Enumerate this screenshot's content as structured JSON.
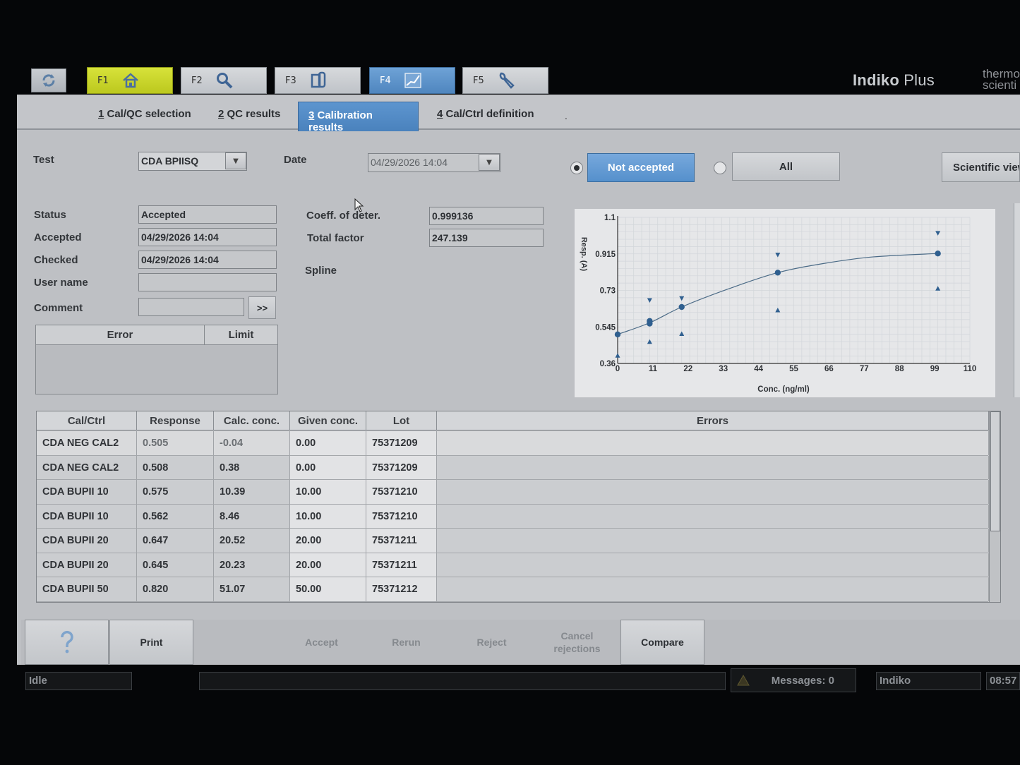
{
  "app": {
    "brand_main": "Indiko",
    "brand_plus": " Plus",
    "vendor_line1": "thermo",
    "vendor_line2": "scienti"
  },
  "fkeys": [
    {
      "label": "F1",
      "icon": "home-icon"
    },
    {
      "label": "F2",
      "icon": "search-icon"
    },
    {
      "label": "F3",
      "icon": "sample-icon"
    },
    {
      "label": "F4",
      "icon": "chart-icon"
    },
    {
      "label": "F5",
      "icon": "wrench-icon"
    }
  ],
  "tabs": [
    {
      "num": "1",
      "text": " Cal/QC selection"
    },
    {
      "num": "2",
      "text": " QC results"
    },
    {
      "num": "3",
      "text": " Calibration results"
    },
    {
      "num": "4",
      "text": " Cal/Ctrl definition"
    }
  ],
  "form": {
    "test_label": "Test",
    "test_value": "CDA BPIISQ",
    "date_label": "Date",
    "date_value": "04/29/2026 14:04",
    "status_label": "Status",
    "status_value": "Accepted",
    "accepted_label": "Accepted",
    "accepted_value": "04/29/2026 14:04",
    "checked_label": "Checked",
    "checked_value": "04/29/2026 14:04",
    "username_label": "User name",
    "username_value": "",
    "comment_label": "Comment",
    "comment_value": "",
    "more_button": ">>",
    "coeff_label": "Coeff. of deter.",
    "coeff_value": "0.999136",
    "total_factor_label": "Total factor",
    "total_factor_value": "247.139",
    "method": "Spline"
  },
  "filter": {
    "not_accepted": "Not accepted",
    "all": "All",
    "selected": "not_accepted",
    "scientific_view": "Scientific view"
  },
  "error_table": {
    "col_error": "Error",
    "col_limit": "Limit"
  },
  "chart_data": {
    "type": "scatter",
    "xlabel": "Conc. (ng/ml)",
    "ylabel": "Resp. (A)",
    "xlim": [
      0,
      110
    ],
    "ylim": [
      0.36,
      1.1
    ],
    "x_ticks": [
      "0",
      "11",
      "22",
      "33",
      "44",
      "55",
      "66",
      "77",
      "88",
      "99",
      "110"
    ],
    "y_ticks": [
      "1.1",
      "0.915",
      "0.73",
      "0.545",
      "0.36"
    ],
    "grid": true,
    "series": [
      {
        "name": "",
        "marker": "circle",
        "x": [
          0,
          10,
          10,
          20,
          50,
          100
        ],
        "y": [
          0.507,
          0.575,
          0.562,
          0.646,
          0.82,
          0.917
        ]
      },
      {
        "name": "",
        "marker": "triangle-down",
        "x": [
          10,
          20,
          50,
          100
        ],
        "y": [
          0.68,
          0.69,
          0.91,
          1.02
        ]
      },
      {
        "name": "",
        "marker": "triangle-up",
        "x": [
          0,
          10,
          20,
          50,
          100
        ],
        "y": [
          0.4,
          0.47,
          0.51,
          0.63,
          0.74
        ]
      }
    ],
    "curve": {
      "x": [
        0,
        10,
        20,
        35,
        50,
        65,
        80,
        100
      ],
      "y": [
        0.507,
        0.566,
        0.646,
        0.74,
        0.82,
        0.868,
        0.9,
        0.917
      ]
    }
  },
  "data_table": {
    "headers": [
      "Cal/Ctrl",
      "Response",
      "Calc. conc.",
      "Given conc.",
      "Lot",
      "Errors"
    ],
    "rows": [
      [
        "CDA NEG CAL2",
        "0.505",
        "-0.04",
        "0.00",
        "75371209",
        ""
      ],
      [
        "CDA NEG CAL2",
        "0.508",
        "0.38",
        "0.00",
        "75371209",
        ""
      ],
      [
        "CDA BUPII 10",
        "0.575",
        "10.39",
        "10.00",
        "75371210",
        ""
      ],
      [
        "CDA BUPII 10",
        "0.562",
        "8.46",
        "10.00",
        "75371210",
        ""
      ],
      [
        "CDA BUPII 20",
        "0.647",
        "20.52",
        "20.00",
        "75371211",
        ""
      ],
      [
        "CDA BUPII 20",
        "0.645",
        "20.23",
        "20.00",
        "75371211",
        ""
      ],
      [
        "CDA BUPII 50",
        "0.820",
        "51.07",
        "50.00",
        "75371212",
        ""
      ]
    ]
  },
  "toolbar": {
    "help_icon": "question-mark-icon",
    "print": "Print",
    "accept": "Accept",
    "rerun": "Rerun",
    "reject": "Reject",
    "cancel_rejections_1": "Cancel",
    "cancel_rejections_2": "rejections",
    "compare": "Compare"
  },
  "status_bar": {
    "state": "Idle",
    "message_area": "",
    "messages": "Messages: 0",
    "user": "Indiko",
    "time": "08:57"
  }
}
